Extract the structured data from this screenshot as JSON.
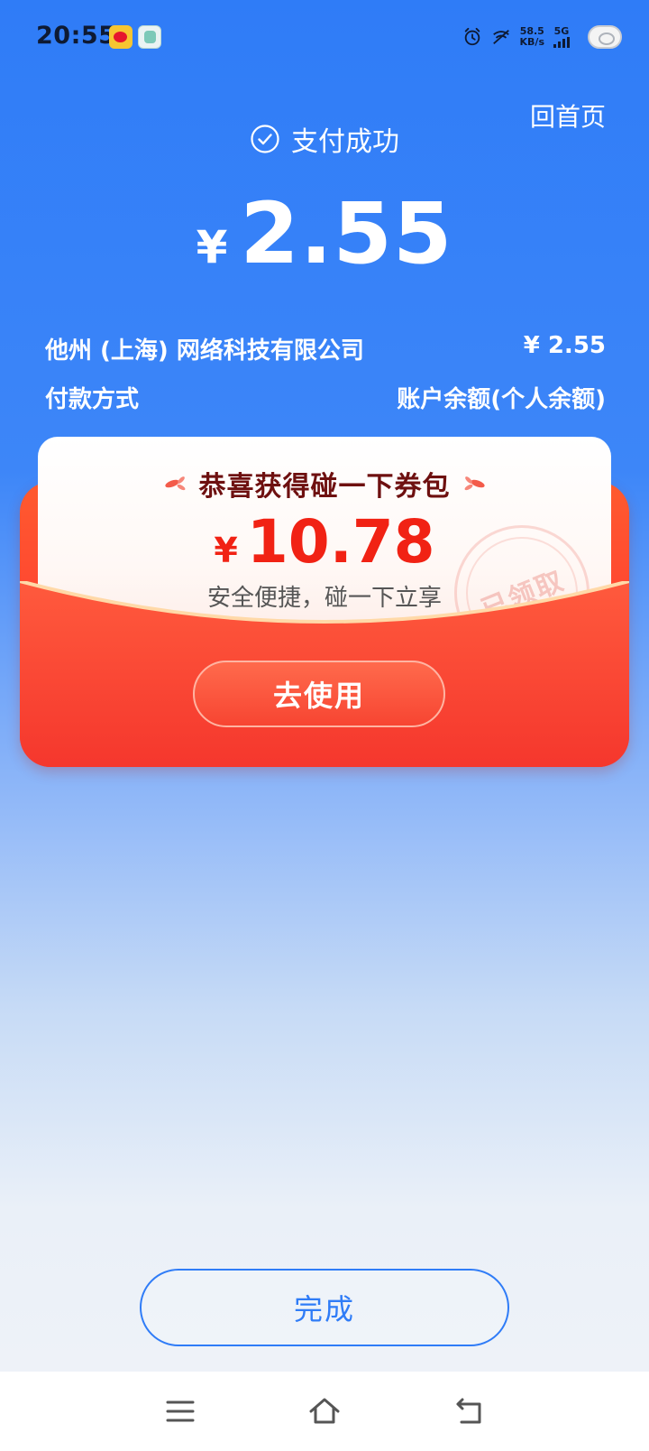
{
  "status_bar": {
    "time": "20:55",
    "net_speed_value": "58.5",
    "net_speed_unit": "KB/s",
    "network_type": "5G"
  },
  "header": {
    "home_link": "回首页",
    "success_text": "支付成功",
    "currency": "¥",
    "amount": "2.55"
  },
  "details": {
    "merchant": "他州 (上海) 网络科技有限公司",
    "merchant_amount": "¥ 2.55",
    "payment_method_label": "付款方式",
    "payment_method_value": "账户余额(个人余额)"
  },
  "coupon": {
    "title": "恭喜获得碰一下券包",
    "currency": "¥",
    "amount": "10.78",
    "subtitle": "安全便捷，碰一下立享",
    "stamp": "已领取",
    "use_button": "去使用"
  },
  "footer": {
    "done_button": "完成"
  },
  "colors": {
    "primary_blue": "#2f7cf7",
    "coupon_red": "#f12214",
    "envelope_red": "#ff4a30"
  },
  "icons": [
    "check-circle-icon",
    "alarm-icon",
    "no-signal-icon",
    "signal-bars-icon",
    "battery-icon",
    "sparkle-icon",
    "menu-icon",
    "home-icon",
    "back-icon"
  ]
}
